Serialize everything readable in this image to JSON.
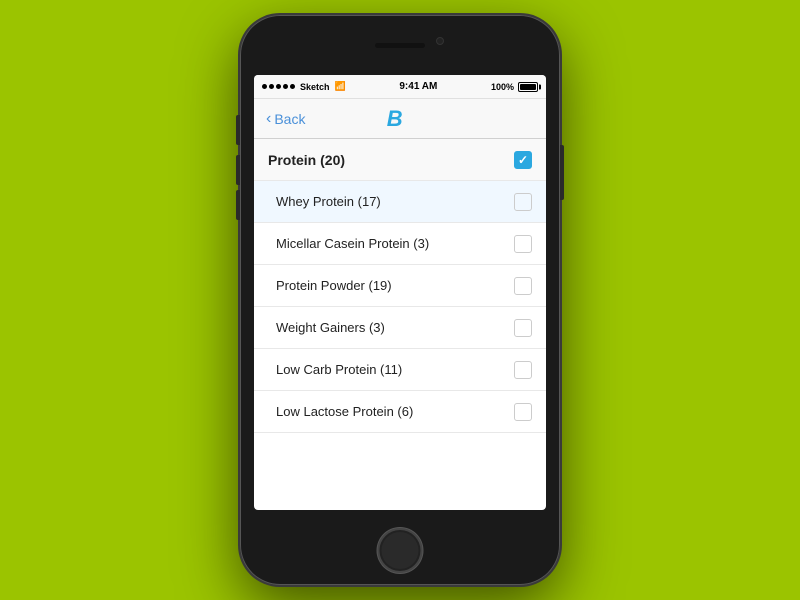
{
  "statusBar": {
    "carrier": "Sketch",
    "time": "9:41 AM",
    "battery": "100%"
  },
  "navBar": {
    "back": "Back",
    "logo": "B"
  },
  "list": {
    "parent": {
      "label": "Protein (20)",
      "checked": true
    },
    "children": [
      {
        "label": "Whey Protein (17)",
        "checked": false,
        "highlighted": true
      },
      {
        "label": "Micellar Casein Protein (3)",
        "checked": false,
        "highlighted": false
      },
      {
        "label": "Protein Powder (19)",
        "checked": false,
        "highlighted": false
      },
      {
        "label": "Weight Gainers (3)",
        "checked": false,
        "highlighted": false
      },
      {
        "label": "Low Carb Protein (11)",
        "checked": false,
        "highlighted": false
      },
      {
        "label": "Low Lactose Protein (6)",
        "checked": false,
        "highlighted": false
      }
    ]
  }
}
